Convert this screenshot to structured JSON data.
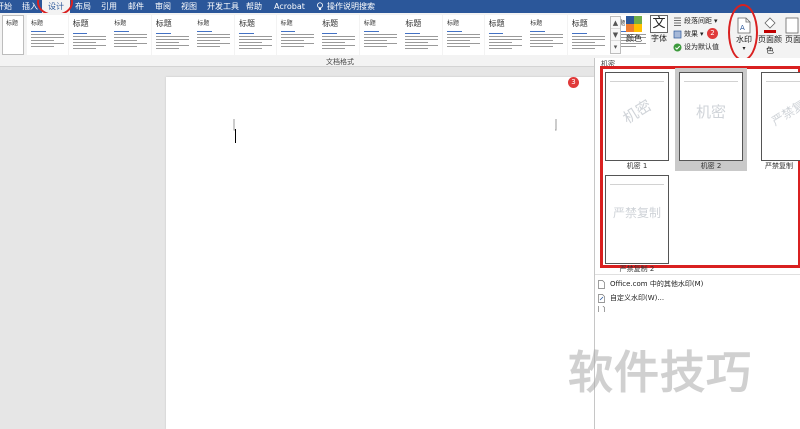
{
  "tabs": {
    "home": "开始",
    "insert": "插入",
    "design": "设计",
    "layout": "布局",
    "references": "引用",
    "mailings": "邮件",
    "review": "审阅",
    "view": "视图",
    "developer": "开发工具",
    "help": "帮助",
    "acrobat": "Acrobat",
    "tell_me": "操作说明搜索"
  },
  "ribbon": {
    "style_gallery_titles": [
      "标题",
      "标题",
      "标题",
      "标题",
      "标题",
      "标题",
      "标题",
      "标题",
      "标题",
      "标题",
      "标题",
      "标题",
      "标题",
      "标题",
      "标题"
    ],
    "style_gallery_first": "标题",
    "document_formatting_label": "文档格式",
    "colors_label": "颜色",
    "fonts_label": "字体",
    "paragraph_spacing_label": "段落间距",
    "effects_label": "效果",
    "set_default_label": "设为默认值",
    "watermark_label": "水印",
    "page_color_label": "页面颜色",
    "page_borders_label": "页面"
  },
  "badges": {
    "step2": "2",
    "step3": "3"
  },
  "watermark_menu": {
    "heading": "机密",
    "thumbnails": [
      {
        "label": "机密 1",
        "text": "机密",
        "style": "diagonal"
      },
      {
        "label": "机密 2",
        "text": "机密",
        "style": "horizontal",
        "selected": true
      },
      {
        "label": "严禁复制",
        "text": "严禁复制",
        "style": "diagonal"
      },
      {
        "label": "严禁复制 2",
        "text": "严禁复制",
        "style": "horizontal"
      }
    ],
    "more_from_office": "Office.com 中的其他水印(M)",
    "custom_watermark": "自定义水印(W)..."
  },
  "site_watermark": "软件技巧",
  "colors": {
    "accent": "#2b579a",
    "highlight": "#d92020",
    "badge": "#e03a3a"
  }
}
